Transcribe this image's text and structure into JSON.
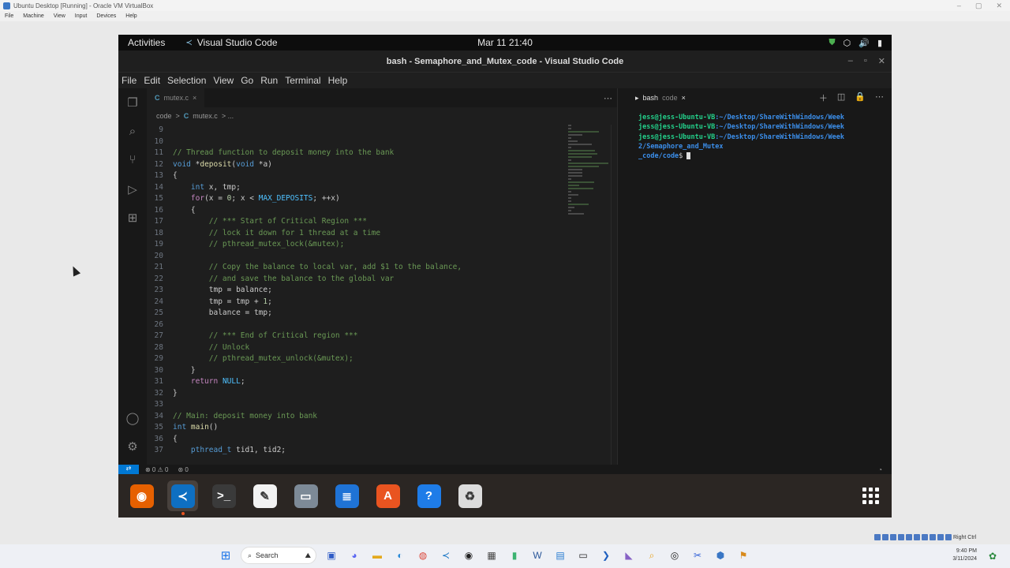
{
  "vbox": {
    "window_title": "Ubuntu Desktop [Running] - Oracle VM VirtualBox",
    "menu": [
      "File",
      "Machine",
      "View",
      "Input",
      "Devices",
      "Help"
    ],
    "right_ctrl_label": "Right Ctrl"
  },
  "gnome": {
    "activities": "Activities",
    "app_name": "Visual Studio Code",
    "clock": "Mar 11  21:40"
  },
  "vscode": {
    "window_title": "bash - Semaphore_and_Mutex_code - Visual Studio Code",
    "menu": [
      "File",
      "Edit",
      "Selection",
      "View",
      "Go",
      "Run",
      "Terminal",
      "Help"
    ],
    "tab": {
      "badge": "C",
      "label": "mutex.c",
      "close": "×"
    },
    "breadcrumb": {
      "folder": "code",
      "sep": ">",
      "badge": "C",
      "file": "mutex.c",
      "tail": "> ..."
    },
    "code_lines": [
      {
        "n": "9",
        "t": ""
      },
      {
        "n": "10",
        "t": ""
      },
      {
        "n": "11",
        "t": "// Thread function to deposit money into the bank",
        "c": "comment"
      },
      {
        "n": "12",
        "t": "void *deposit(void *a)"
      },
      {
        "n": "13",
        "t": "{"
      },
      {
        "n": "14",
        "t": "    int x, tmp;"
      },
      {
        "n": "15",
        "t": "    for(x = 0; x < MAX_DEPOSITS; ++x)"
      },
      {
        "n": "16",
        "t": "    {"
      },
      {
        "n": "17",
        "t": "        // *** Start of Critical Region ***",
        "c": "comment"
      },
      {
        "n": "18",
        "t": "        // lock it down for 1 thread at a time",
        "c": "comment"
      },
      {
        "n": "19",
        "t": "        // pthread_mutex_lock(&mutex);",
        "c": "comment"
      },
      {
        "n": "20",
        "t": ""
      },
      {
        "n": "21",
        "t": "        // Copy the balance to local var, add $1 to the balance,",
        "c": "comment"
      },
      {
        "n": "22",
        "t": "        // and save the balance to the global var",
        "c": "comment"
      },
      {
        "n": "23",
        "t": "        tmp = balance;"
      },
      {
        "n": "24",
        "t": "        tmp = tmp + 1;"
      },
      {
        "n": "25",
        "t": "        balance = tmp;"
      },
      {
        "n": "26",
        "t": ""
      },
      {
        "n": "27",
        "t": "        // *** End of Critical region ***",
        "c": "comment"
      },
      {
        "n": "28",
        "t": "        // Unlock",
        "c": "comment"
      },
      {
        "n": "29",
        "t": "        // pthread_mutex_unlock(&mutex);",
        "c": "comment"
      },
      {
        "n": "30",
        "t": "    }"
      },
      {
        "n": "31",
        "t": "    return NULL;"
      },
      {
        "n": "32",
        "t": "}"
      },
      {
        "n": "33",
        "t": ""
      },
      {
        "n": "34",
        "t": "// Main: deposit money into bank",
        "c": "comment"
      },
      {
        "n": "35",
        "t": "int main()"
      },
      {
        "n": "36",
        "t": "{"
      },
      {
        "n": "37",
        "t": "    pthread_t tid1, tid2;"
      }
    ],
    "terminal": {
      "tab_label": "bash",
      "tab_sub": "code",
      "close": "×",
      "lines": [
        {
          "user": "jess@jess-Ubuntu-VB",
          "path": ":~/Desktop/ShareWithWindows/Week"
        },
        {
          "user": "jess@jess-Ubuntu-VB",
          "path": ":~/Desktop/ShareWithWindows/Week"
        },
        {
          "user": "jess@jess-Ubuntu-VB",
          "path": ":~/Desktop/ShareWithWindows/Week"
        }
      ],
      "wrap1": " 2/Semaphore_and_Mutex",
      "wrap2": " _code/code",
      "prompt_end": "$ "
    },
    "status": {
      "remote": "⇄",
      "problems": "⊗ 0 ⚠ 0",
      "ports": "⊛ 0",
      "bell": "🔔"
    }
  },
  "dock_items": [
    {
      "name": "firefox",
      "glyph": "◉",
      "color": "#e66000"
    },
    {
      "name": "vscode",
      "glyph": "≺",
      "color": "#0e6fc2",
      "active": true
    },
    {
      "name": "terminal",
      "glyph": ">_",
      "color": "#3a3a3a"
    },
    {
      "name": "text-editor",
      "glyph": "✎",
      "color": "#f2f2f2"
    },
    {
      "name": "files",
      "glyph": "▭",
      "color": "#7d8a97"
    },
    {
      "name": "libreoffice-writer",
      "glyph": "≣",
      "color": "#1f73d6"
    },
    {
      "name": "app-center",
      "glyph": "A",
      "color": "#e95420"
    },
    {
      "name": "help",
      "glyph": "?",
      "color": "#1e7ce8"
    },
    {
      "name": "trash",
      "glyph": "♻",
      "color": "#dcdcdc"
    }
  ],
  "host": {
    "search_label": "Search",
    "time": "9:40 PM",
    "date": "3/11/2024"
  }
}
